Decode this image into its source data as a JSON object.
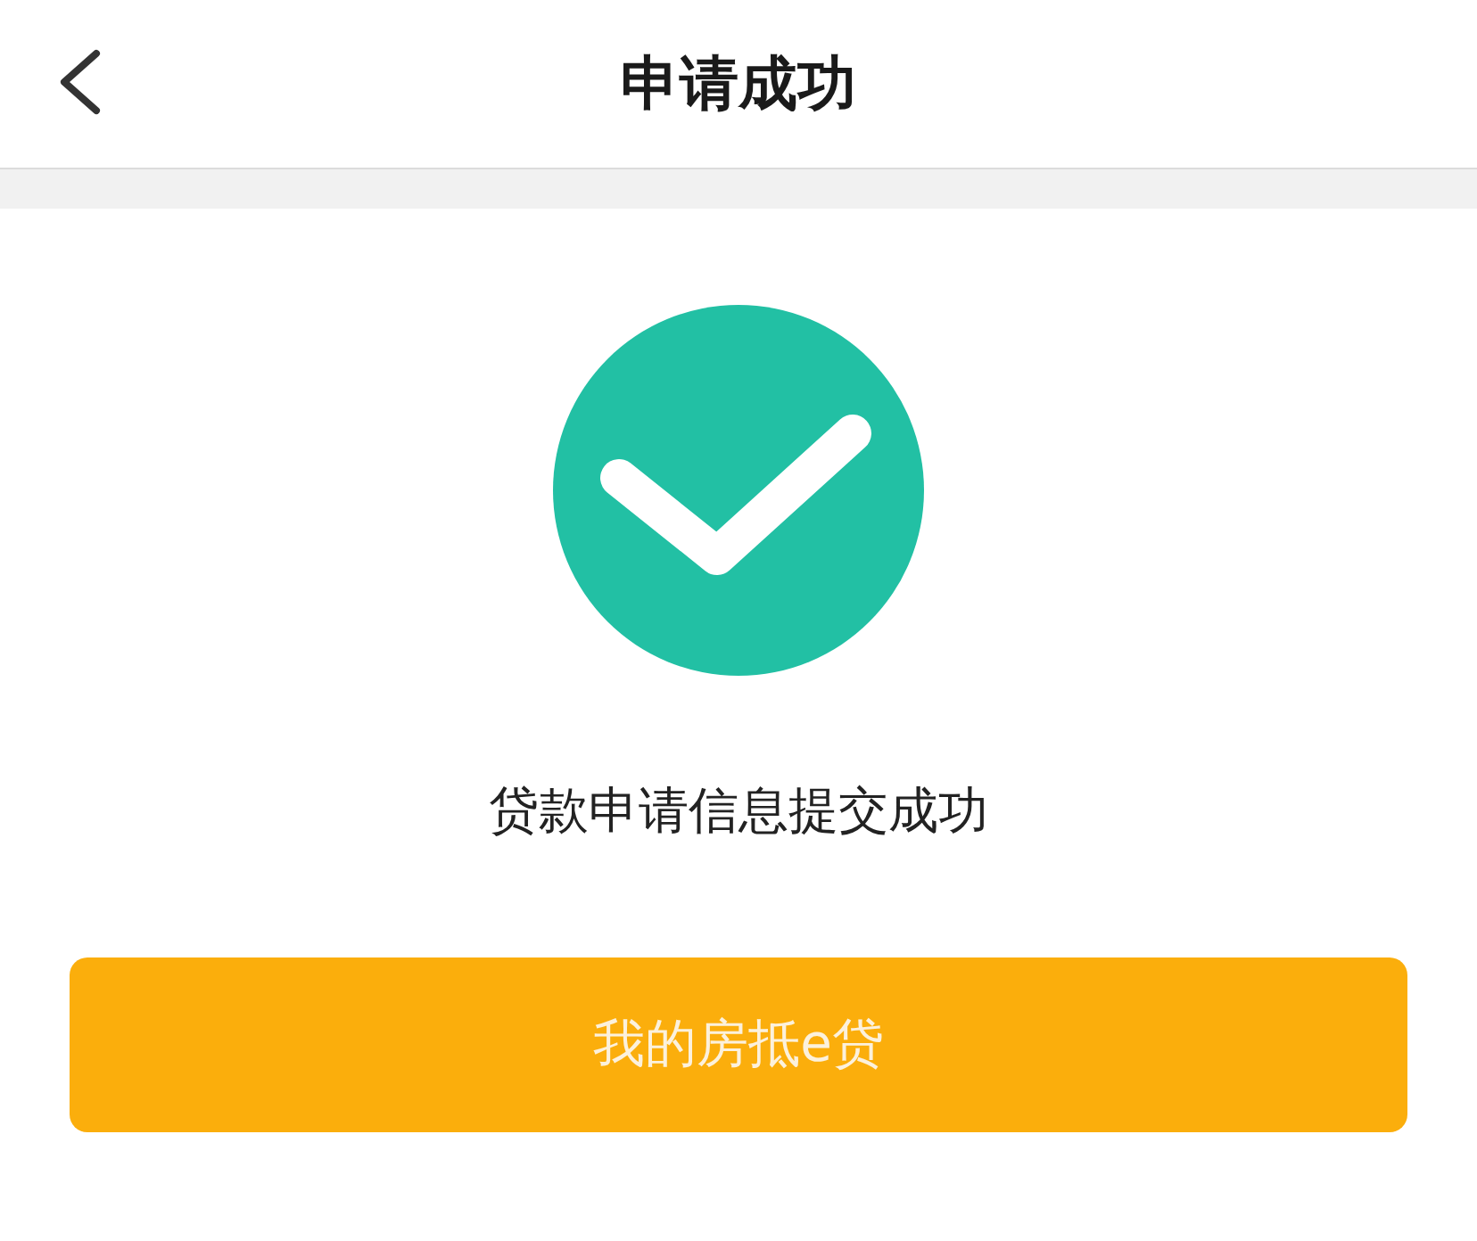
{
  "header": {
    "title": "申请成功"
  },
  "result": {
    "kind": "success",
    "message": "贷款申请信息提交成功"
  },
  "button": {
    "label": "我的房抵e贷"
  }
}
